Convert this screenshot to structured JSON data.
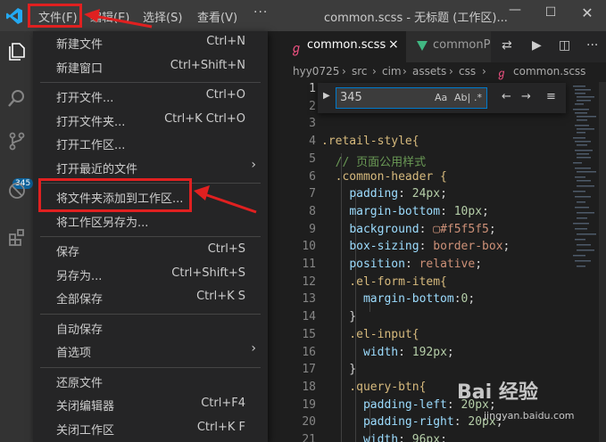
{
  "titlebar": {
    "menus": {
      "file": "文件(F)",
      "edit": "编辑(E)",
      "select": "选择(S)",
      "view": "查看(V)",
      "more": "···"
    },
    "window_title": "common.scss - 无标题 (工作区)...",
    "controls": {
      "minimize": "—",
      "maximize": "☐",
      "close": "✕"
    }
  },
  "activity_bar": {
    "badge": "345"
  },
  "file_menu": {
    "groups": [
      [
        {
          "label": "新建文件",
          "shortcut": "Ctrl+N"
        },
        {
          "label": "新建窗口",
          "shortcut": "Ctrl+Shift+N"
        }
      ],
      [
        {
          "label": "打开文件...",
          "shortcut": "Ctrl+O"
        },
        {
          "label": "打开文件夹...",
          "shortcut": "Ctrl+K Ctrl+O"
        },
        {
          "label": "打开工作区...",
          "shortcut": ""
        },
        {
          "label": "打开最近的文件",
          "shortcut": "",
          "submenu": true
        }
      ],
      [
        {
          "label": "将文件夹添加到工作区...",
          "shortcut": ""
        },
        {
          "label": "将工作区另存为...",
          "shortcut": ""
        }
      ],
      [
        {
          "label": "保存",
          "shortcut": "Ctrl+S"
        },
        {
          "label": "另存为...",
          "shortcut": "Ctrl+Shift+S"
        },
        {
          "label": "全部保存",
          "shortcut": "Ctrl+K S"
        }
      ],
      [
        {
          "label": "自动保存",
          "shortcut": ""
        },
        {
          "label": "首选项",
          "shortcut": "",
          "submenu": true
        }
      ],
      [
        {
          "label": "还原文件",
          "shortcut": ""
        },
        {
          "label": "关闭编辑器",
          "shortcut": "Ctrl+F4"
        },
        {
          "label": "关闭工作区",
          "shortcut": "Ctrl+K F"
        }
      ]
    ]
  },
  "editor": {
    "tabs": [
      {
        "name": "common.scss",
        "active": true,
        "close": "×"
      },
      {
        "name": "commonP",
        "active": false
      }
    ],
    "breadcrumb": [
      "hyy0725",
      "src",
      "cim",
      "assets",
      "css",
      "common.scss"
    ],
    "breadcrumb_sep": "›",
    "find": {
      "value": "345",
      "options": [
        "Aa",
        "Ab|",
        ".*"
      ]
    },
    "line_numbers": [
      "1",
      "2",
      "3",
      "4",
      "5",
      "6",
      "7",
      "8",
      "9",
      "10",
      "11",
      "12",
      "13",
      "14",
      "15",
      "16",
      "17",
      "18",
      "19",
      "20",
      "21"
    ],
    "code": [
      "",
      "",
      "",
      ".retail-style{",
      "  // 页面公用样式",
      "  .common-header {",
      "    padding: 24px;",
      "    margin-bottom: 10px;",
      "    background: ▢#f5f5f5;",
      "    box-sizing: border-box;",
      "    position: relative;",
      "    .el-form-item{",
      "      margin-bottom:0;",
      "    }",
      "    .el-input{",
      "      width: 192px;",
      "    }",
      "    .query-btn{",
      "      padding-left: 20px;",
      "      padding-right: 20px;",
      "      width: 96px;"
    ]
  },
  "watermark": {
    "brand": "Bai 经验",
    "url": "jingyan.baidu.com"
  },
  "colors": {
    "highlight_red": "#e02020",
    "selector_yellow": "#d7ba7d",
    "property_blue": "#9cdcfe",
    "value_orange": "#ce9178",
    "comment_green": "#6a9955",
    "number_green": "#b5cea8"
  }
}
